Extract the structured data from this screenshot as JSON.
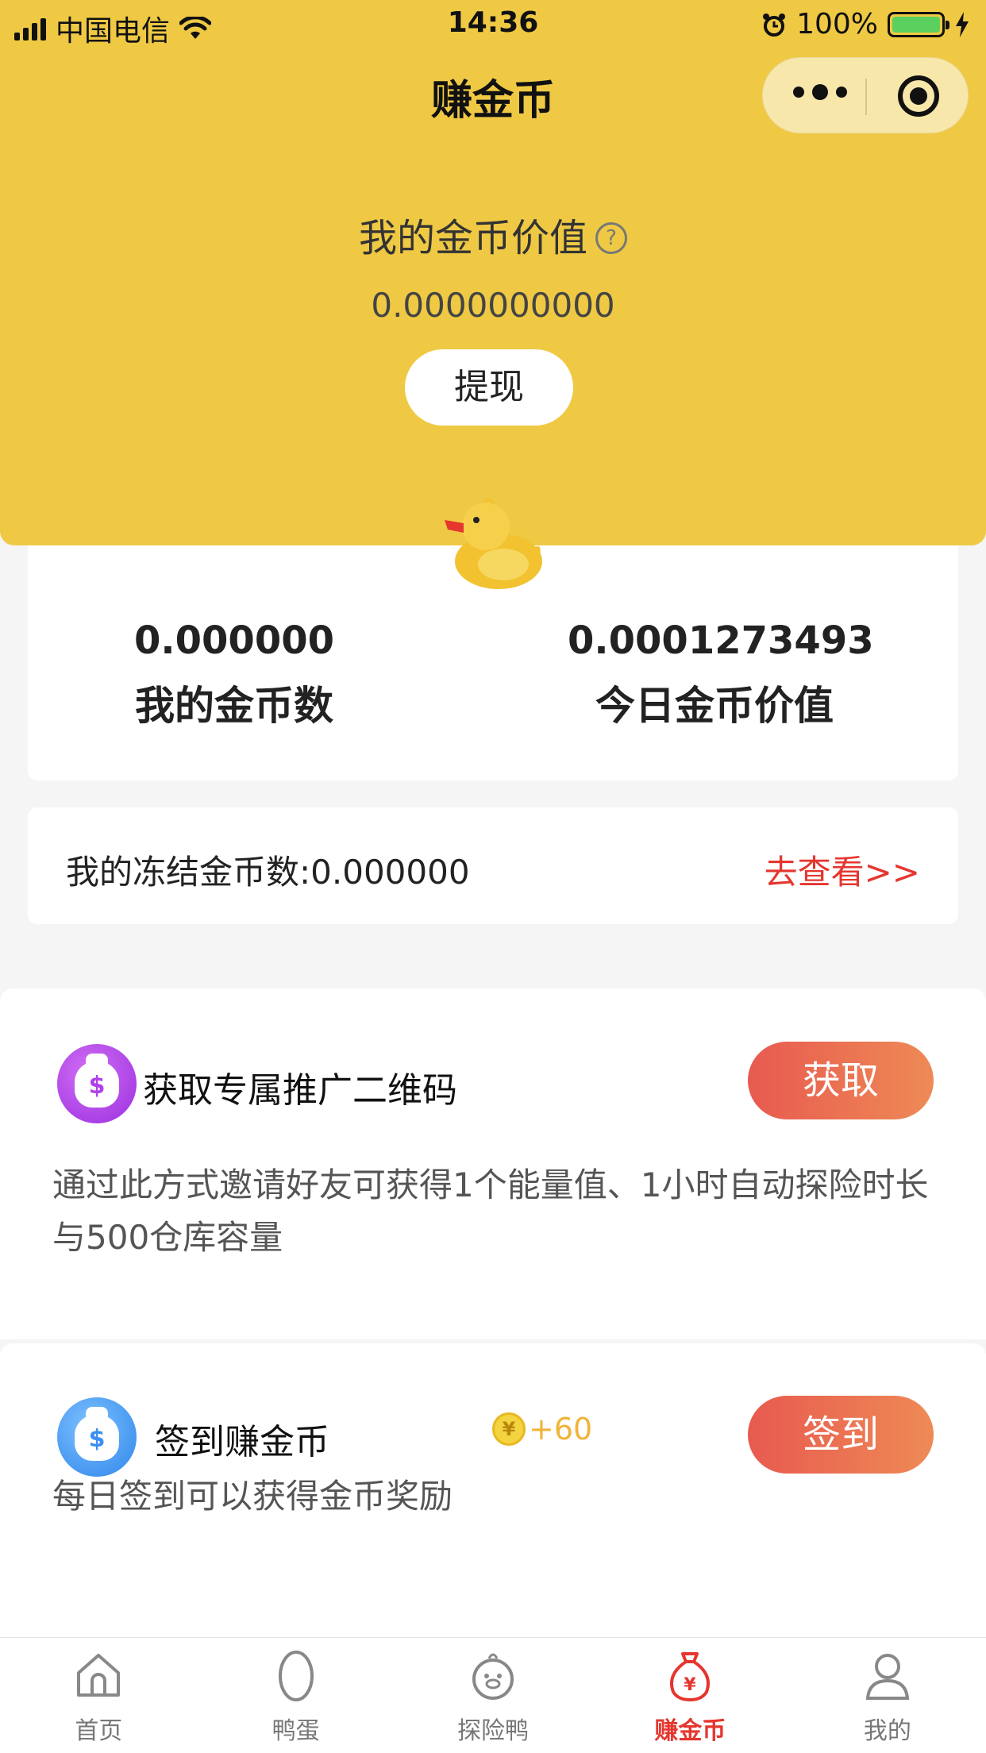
{
  "status_bar": {
    "carrier": "中国电信",
    "time": "14:36",
    "battery": "100%"
  },
  "nav": {
    "title": "赚金币"
  },
  "header": {
    "title": "我的金币价值",
    "help_icon": "?",
    "value": "0.0000000000",
    "withdraw_label": "提现"
  },
  "stats": {
    "my_coins_value": "0.000000",
    "my_coins_label": "我的金币数",
    "today_value": "0.0001273493",
    "today_label": "今日金币价值"
  },
  "frozen": {
    "label": "我的冻结金币数:0.000000",
    "link": "去查看>>"
  },
  "tasks": [
    {
      "icon": "money-bag-icon",
      "title": "获取专属推广二维码",
      "button": "获取",
      "description": "通过此方式邀请好友可获得1个能量值、1小时自动探险时长与500仓库容量"
    },
    {
      "icon": "money-bag-icon",
      "title": "签到赚金币",
      "reward_coin": "¥",
      "reward": "+60",
      "button": "签到",
      "description": "每日签到可以获得金币奖励"
    }
  ],
  "tab_bar": {
    "items": [
      {
        "label": "首页",
        "icon": "home-icon"
      },
      {
        "label": "鸭蛋",
        "icon": "egg-icon"
      },
      {
        "label": "探险鸭",
        "icon": "duck-icon"
      },
      {
        "label": "赚金币",
        "icon": "money-bag-icon",
        "active": true
      },
      {
        "label": "我的",
        "icon": "user-icon"
      }
    ]
  },
  "colors": {
    "brand_yellow": "#efc944",
    "accent_red": "#e5362f",
    "button_gradient_start": "#e85a50",
    "button_gradient_end": "#ee8a56"
  }
}
